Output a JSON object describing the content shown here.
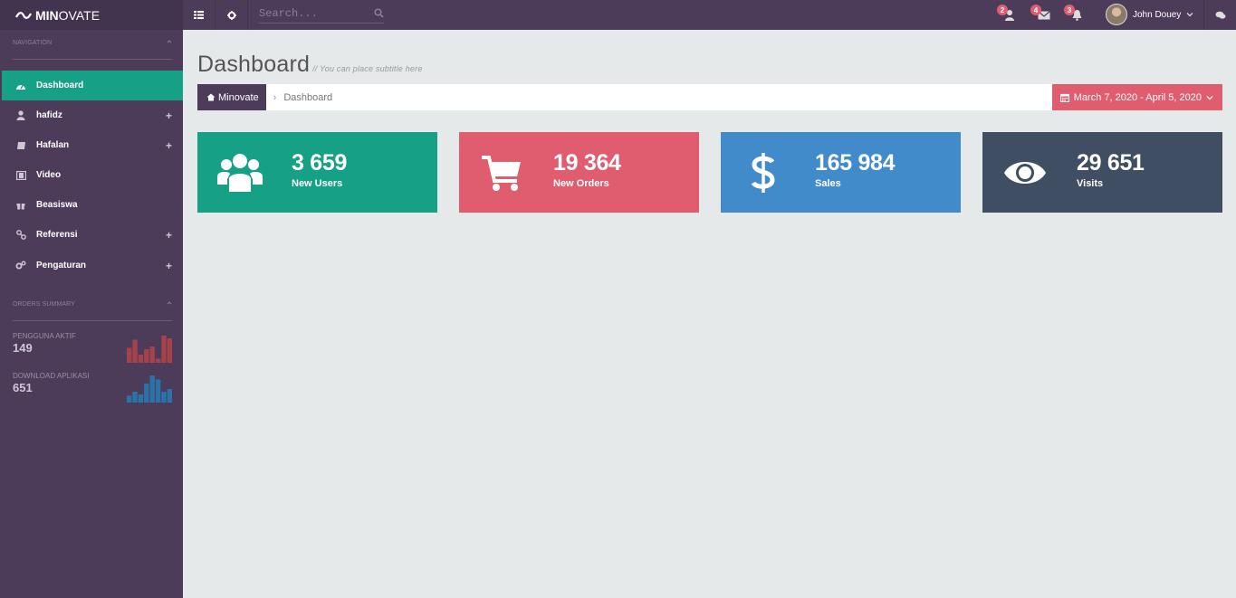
{
  "brand": {
    "bold": "MIN",
    "light": "OVATE"
  },
  "topbar": {
    "search_placeholder": "Search...",
    "notifications": [
      {
        "icon": "user-alert-icon",
        "count": "2"
      },
      {
        "icon": "envelope-icon",
        "count": "4"
      },
      {
        "icon": "bell-icon",
        "count": "3"
      }
    ],
    "user_name": "John Douey"
  },
  "sidebar": {
    "nav_title": "NAVIGATION",
    "items": [
      {
        "label": "Dashboard",
        "icon": "dashboard-icon",
        "active": true,
        "expandable": false
      },
      {
        "label": "hafidz",
        "icon": "user-icon",
        "active": false,
        "expandable": true
      },
      {
        "label": "Hafalan",
        "icon": "book-icon",
        "active": false,
        "expandable": true
      },
      {
        "label": "Video",
        "icon": "film-icon",
        "active": false,
        "expandable": false
      },
      {
        "label": "Beasiswa",
        "icon": "gift-icon",
        "active": false,
        "expandable": false
      },
      {
        "label": "Referensi",
        "icon": "link-icon",
        "active": false,
        "expandable": true
      },
      {
        "label": "Pengaturan",
        "icon": "cogs-icon",
        "active": false,
        "expandable": true
      }
    ],
    "expand_symbol": "+",
    "summary_title": "ORDERS SUMMARY",
    "summary": [
      {
        "label": "PENGGUNA AKTIF",
        "value": "149",
        "color": "#a7414a",
        "bars": [
          0.55,
          0.85,
          0.3,
          0.5,
          0.6,
          0.15,
          1.0,
          0.9
        ]
      },
      {
        "label": "DOWNLOAD APLIKASI",
        "value": "651",
        "color": "#2a73a8",
        "bars": [
          0.25,
          0.4,
          0.3,
          0.7,
          1.0,
          0.85,
          0.4,
          0.5
        ]
      }
    ]
  },
  "page": {
    "title": "Dashboard",
    "subtitle": "// You can place subtitle here"
  },
  "breadcrumb": {
    "home": "Minovate",
    "separator": "›",
    "current": "Dashboard",
    "daterange": "March 7, 2020 - April 5, 2020"
  },
  "cards": [
    {
      "value": "3 659",
      "label": "New Users",
      "color": "#16a085",
      "icon": "users-icon"
    },
    {
      "value": "19 364",
      "label": "New Orders",
      "color": "#e05d6f",
      "icon": "shopping-cart-icon"
    },
    {
      "value": "165 984",
      "label": "Sales",
      "color": "#418bca",
      "icon": "dollar-icon"
    },
    {
      "value": "29 651",
      "label": "Visits",
      "color": "#3f4e62",
      "icon": "eye-icon"
    }
  ],
  "colors": {
    "topbar": "#4c3c5a",
    "brand_bg": "#42334f",
    "content_bg": "#e5e9e9",
    "active": "#16a085",
    "badge": "#e05d6f"
  }
}
